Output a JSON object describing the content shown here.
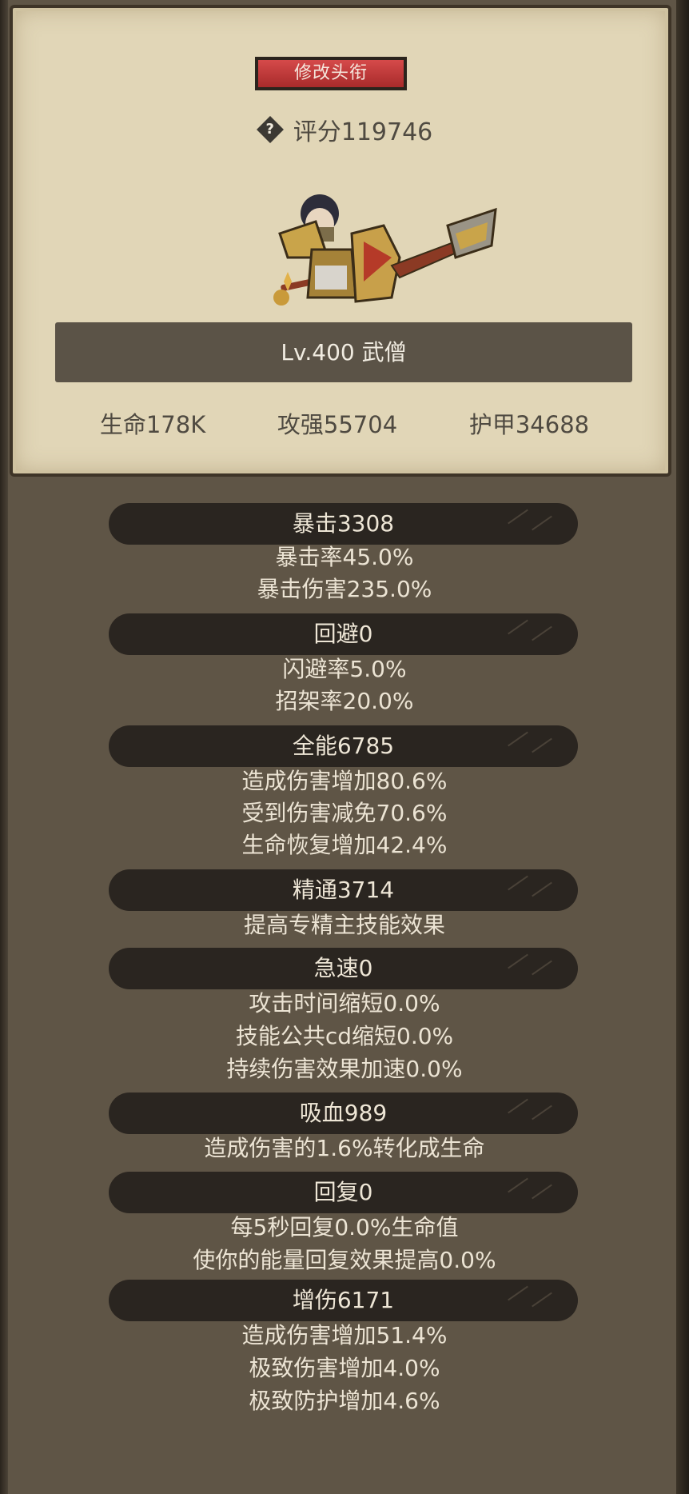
{
  "header": {
    "title_button": "修改头衔",
    "score": "评分119746",
    "level_class": "Lv.400 武僧"
  },
  "stats": {
    "life": "生命178K",
    "attack": "攻强55704",
    "armor": "护甲34688"
  },
  "sections": [
    {
      "title": "暴击3308",
      "lines": [
        "暴击率45.0%",
        "暴击伤害235.0%"
      ]
    },
    {
      "title": "回避0",
      "lines": [
        "闪避率5.0%",
        "招架率20.0%"
      ]
    },
    {
      "title": "全能6785",
      "lines": [
        "造成伤害增加80.6%",
        "受到伤害减免70.6%",
        "生命恢复增加42.4%"
      ]
    },
    {
      "title": "精通3714",
      "lines": [
        "提高专精主技能效果"
      ]
    },
    {
      "title": "急速0",
      "lines": [
        "攻击时间缩短0.0%",
        "技能公共cd缩短0.0%",
        "持续伤害效果加速0.0%"
      ]
    },
    {
      "title": "吸血989",
      "lines": [
        "造成伤害的1.6%转化成生命"
      ]
    },
    {
      "title": "回复0",
      "lines": [
        "每5秒回复0.0%生命值",
        "使你的能量回复效果提高0.0%"
      ]
    },
    {
      "title": "增伤6171",
      "lines": [
        "造成伤害增加51.4%",
        "极致伤害增加4.0%",
        "极致防护增加4.6%"
      ]
    }
  ],
  "colors": {
    "parchment": "#e1d6b7",
    "panel_bg": "#5f5546",
    "header_band": "#2a2520",
    "title_button": "#c23b3b"
  },
  "icons": {
    "help": "help-icon"
  }
}
